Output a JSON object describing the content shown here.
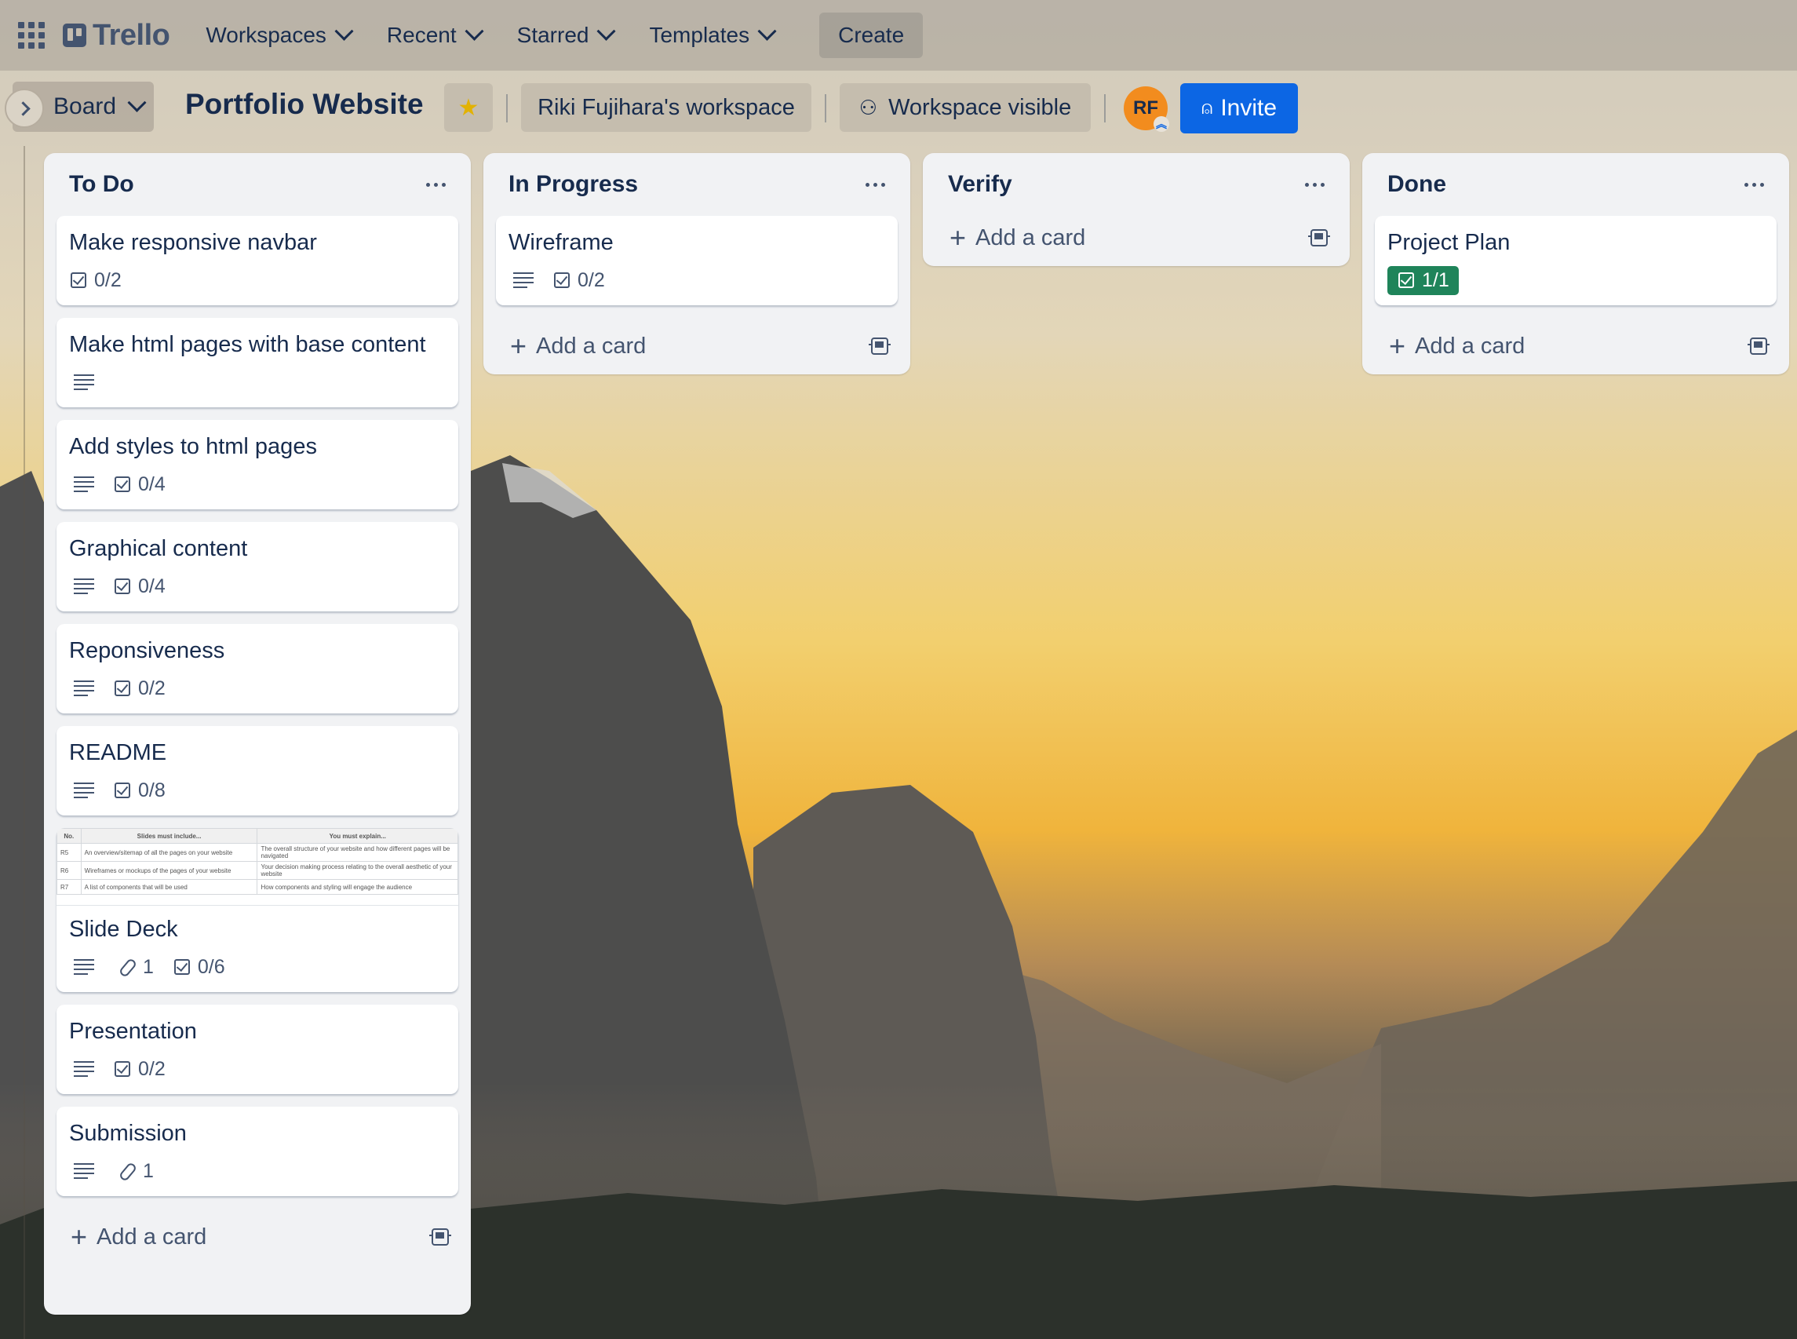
{
  "app": {
    "logo_text": "Trello",
    "nav": [
      {
        "label": "Workspaces"
      },
      {
        "label": "Recent"
      },
      {
        "label": "Starred"
      },
      {
        "label": "Templates"
      }
    ],
    "create_label": "Create"
  },
  "board": {
    "view_label": "Board",
    "title": "Portfolio Website",
    "workspace_label": "Riki Fujihara's workspace",
    "visibility_label": "Workspace visible",
    "avatar_initials": "RF",
    "invite_label": "Invite",
    "add_card_label": "Add a card"
  },
  "lists": [
    {
      "title": "To Do",
      "cards": [
        {
          "title": "Make responsive navbar",
          "checklist": "0/2"
        },
        {
          "title": "Make html pages with base content"
        },
        {
          "title": "Add styles to html pages",
          "checklist": "0/4"
        },
        {
          "title": "Graphical content",
          "checklist": "0/4"
        },
        {
          "title": "Reponsiveness",
          "checklist": "0/2"
        },
        {
          "title": "README",
          "checklist": "0/8"
        },
        {
          "title": "Slide Deck",
          "attachments": "1",
          "checklist": "0/6"
        },
        {
          "title": "Presentation",
          "checklist": "0/2"
        },
        {
          "title": "Submission",
          "attachments": "1"
        }
      ]
    },
    {
      "title": "In Progress",
      "cards": [
        {
          "title": "Wireframe",
          "checklist": "0/2"
        }
      ]
    },
    {
      "title": "Verify",
      "cards": []
    },
    {
      "title": "Done",
      "cards": [
        {
          "title": "Project Plan",
          "checklist": "1/1"
        }
      ]
    }
  ],
  "slide_cover": {
    "headers": [
      "No.",
      "Slides must include...",
      "You must explain..."
    ],
    "rows": [
      [
        "R5",
        "An overview/sitemap of all the pages on your website",
        "The overall structure of your website and how different pages will be navigated"
      ],
      [
        "R6",
        "Wireframes or mockups of the pages of your website",
        "Your decision making process relating to the overall aesthetic of your website"
      ],
      [
        "R7",
        "A list of components that will be used",
        "How components and styling will engage the audience"
      ]
    ]
  },
  "colors": {
    "brand_blue": "#0c66e4",
    "done_green": "#1f845a",
    "avatar_orange": "#f28c1e"
  }
}
